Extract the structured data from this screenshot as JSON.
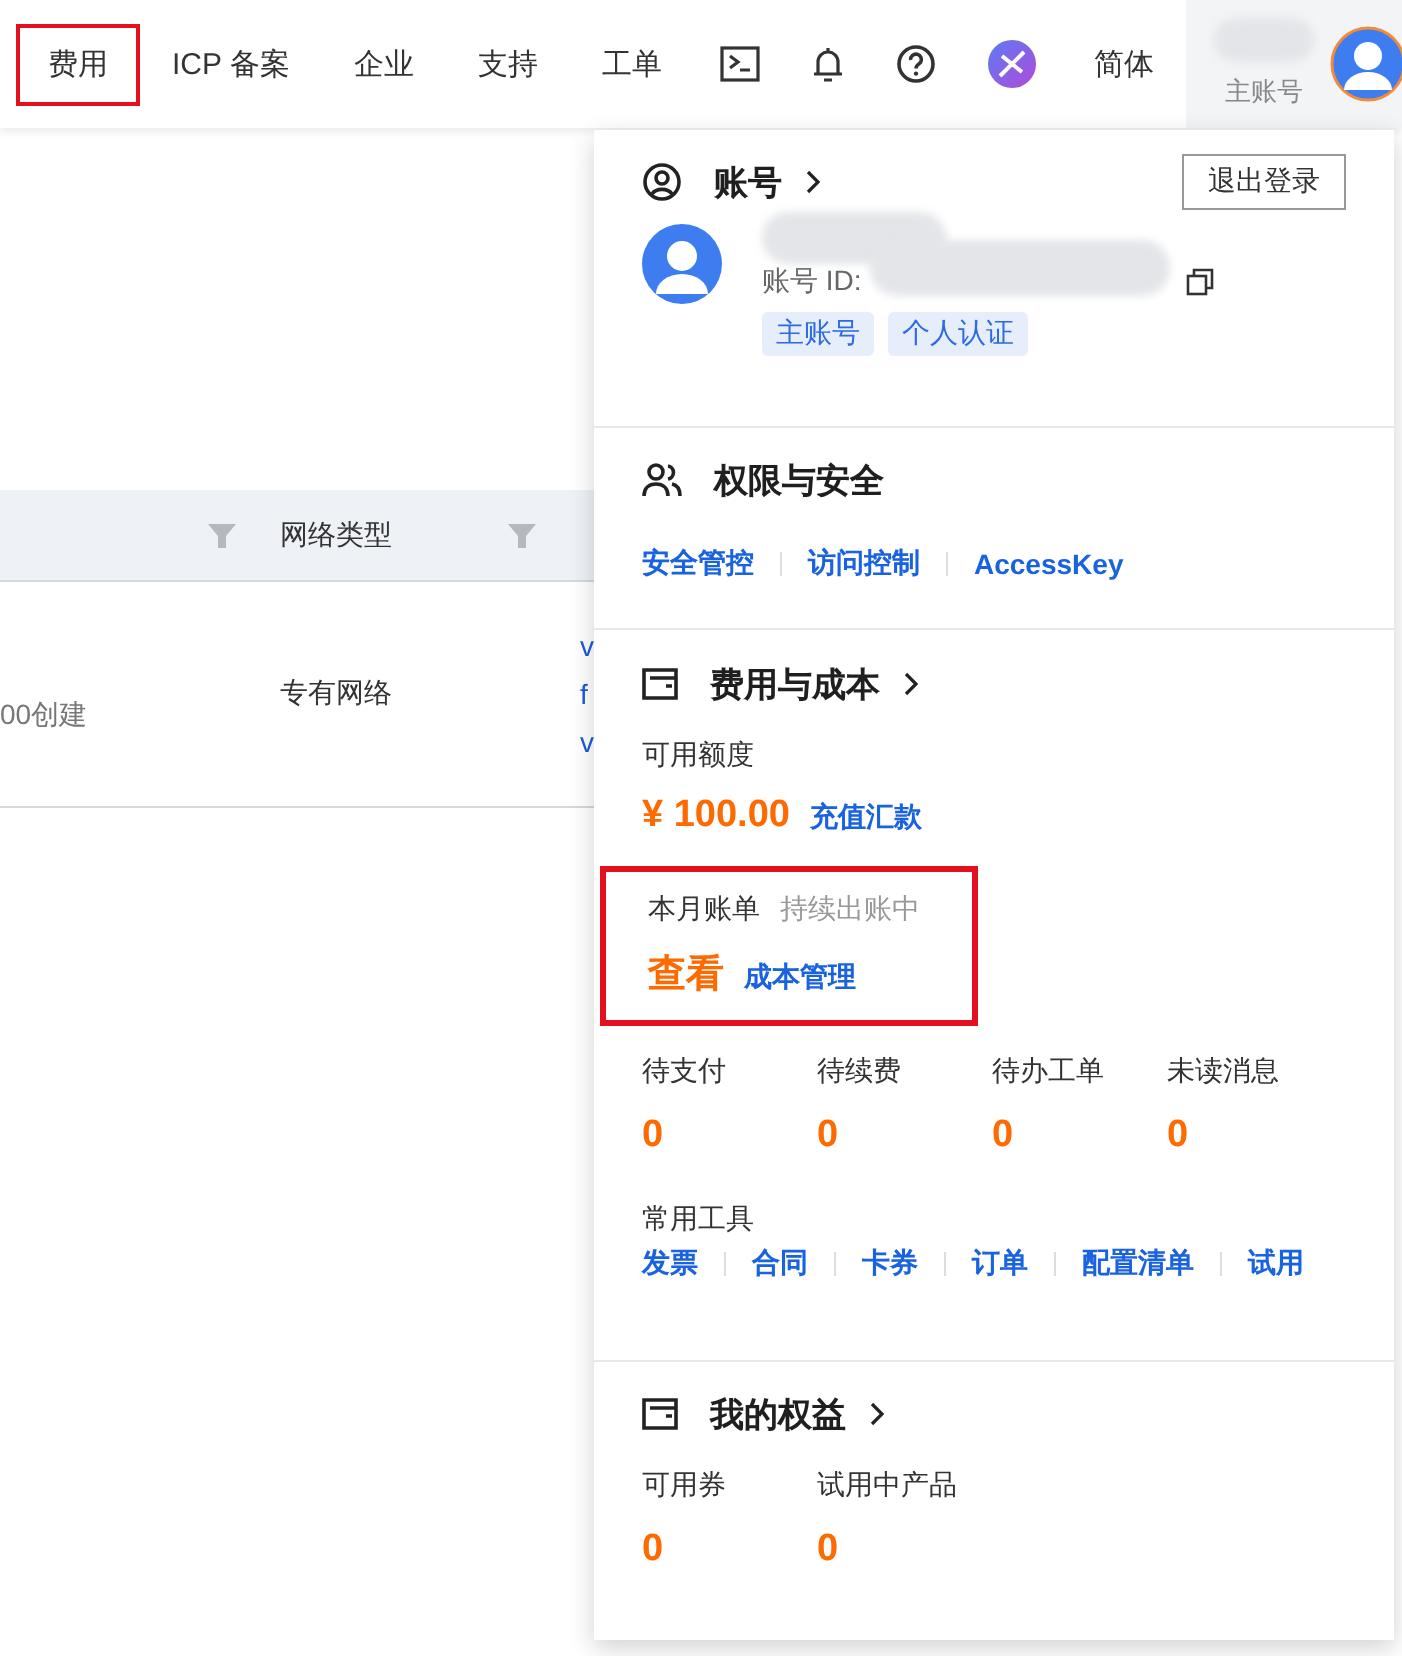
{
  "nav": {
    "items": [
      {
        "kind": "text",
        "label": "费用",
        "highlighted": true
      },
      {
        "kind": "text",
        "label": "ICP 备案",
        "highlighted": false
      },
      {
        "kind": "text",
        "label": "企业",
        "highlighted": false
      },
      {
        "kind": "text",
        "label": "支持",
        "highlighted": false
      },
      {
        "kind": "text",
        "label": "工单",
        "highlighted": false
      },
      {
        "kind": "terminal"
      },
      {
        "kind": "bell"
      },
      {
        "kind": "help"
      },
      {
        "kind": "app"
      },
      {
        "kind": "text",
        "label": "简体",
        "highlighted": false
      }
    ],
    "account_role": "主账号"
  },
  "table": {
    "columns": [
      {
        "filter": true
      },
      {
        "label": "网络类型",
        "filter": true
      }
    ],
    "rows": [
      {
        "created": "00创建",
        "network": "专有网络",
        "links": [
          "v",
          "f",
          "v"
        ]
      }
    ]
  },
  "dropdown": {
    "account": {
      "title": "账号",
      "logout": "退出登录",
      "id_label": "账号 ID:",
      "tags": [
        "主账号",
        "个人认证"
      ]
    },
    "security": {
      "title": "权限与安全",
      "links": [
        "安全管控",
        "访问控制",
        "AccessKey"
      ]
    },
    "billing": {
      "title": "费用与成本",
      "balance_label": "可用额度",
      "balance": "¥ 100.00",
      "recharge": "充值汇款",
      "bill": {
        "label": "本月账单",
        "status": "持续出账中",
        "view": "查看",
        "manage": "成本管理",
        "highlighted": true
      },
      "stats": [
        {
          "label": "待支付",
          "value": "0"
        },
        {
          "label": "待续费",
          "value": "0"
        },
        {
          "label": "待办工单",
          "value": "0"
        },
        {
          "label": "未读消息",
          "value": "0"
        }
      ],
      "tools_label": "常用工具",
      "tools": [
        "发票",
        "合同",
        "卡券",
        "订单",
        "配置清单",
        "试用"
      ]
    },
    "benefits": {
      "title": "我的权益",
      "stats": [
        {
          "label": "可用券",
          "value": "0"
        },
        {
          "label": "试用中产品",
          "value": "0"
        }
      ]
    }
  }
}
